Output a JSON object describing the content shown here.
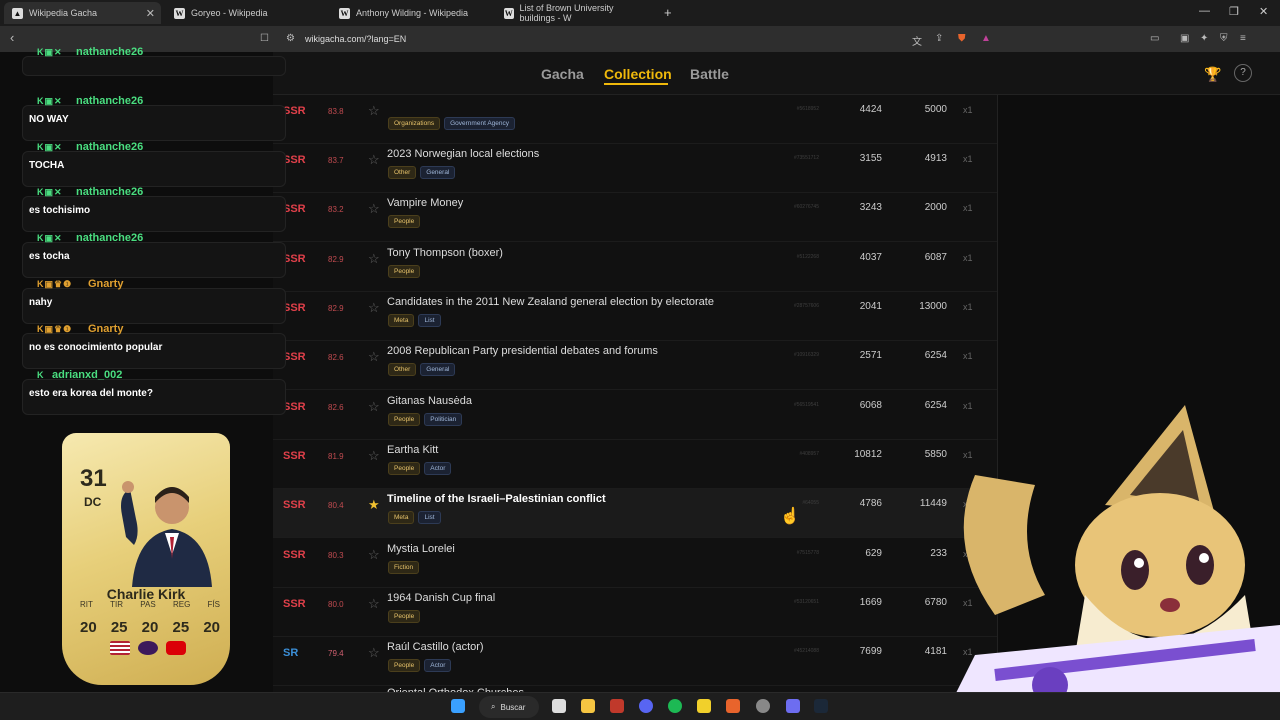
{
  "browser": {
    "tabs": [
      {
        "label": "Wikipedia Gacha",
        "active": true
      },
      {
        "label": "Goryeo - Wikipedia",
        "active": false
      },
      {
        "label": "Anthony Wilding - Wikipedia",
        "active": false
      },
      {
        "label": "List of Brown University buildings - W",
        "active": false
      }
    ],
    "new_tab": "+",
    "url": "wikigacha.com/?lang=EN"
  },
  "site": {
    "nav": [
      {
        "label": "Gacha"
      },
      {
        "label": "Collection",
        "active": true
      },
      {
        "label": "Battle"
      }
    ],
    "help": "?"
  },
  "rows": [
    {
      "rarity": "SSR",
      "score": "83.8",
      "title": "",
      "tags": [
        "Organizations",
        "Government Agency"
      ],
      "id": "#5618952",
      "v1": "4424",
      "v2": "5000",
      "count": "x1",
      "fav": false
    },
    {
      "rarity": "SSR",
      "score": "83.7",
      "title": "2023 Norwegian local elections",
      "tags": [
        "Other",
        "General"
      ],
      "id": "#73551712",
      "v1": "3155",
      "v2": "4913",
      "count": "x1",
      "fav": false
    },
    {
      "rarity": "SSR",
      "score": "83.2",
      "title": "Vampire Money",
      "tags": [
        "People"
      ],
      "id": "#60276745",
      "v1": "3243",
      "v2": "2000",
      "count": "x1",
      "fav": false
    },
    {
      "rarity": "SSR",
      "score": "82.9",
      "title": "Tony Thompson (boxer)",
      "tags": [
        "People"
      ],
      "id": "#5122268",
      "v1": "4037",
      "v2": "6087",
      "count": "x1",
      "fav": false
    },
    {
      "rarity": "SSR",
      "score": "82.9",
      "title": "Candidates in the 2011 New Zealand general election by electorate",
      "tags": [
        "Meta",
        "List"
      ],
      "id": "#28757606",
      "v1": "2041",
      "v2": "13000",
      "count": "x1",
      "fav": false
    },
    {
      "rarity": "SSR",
      "score": "82.6",
      "title": "2008 Republican Party presidential debates and forums",
      "tags": [
        "Other",
        "General"
      ],
      "id": "#10916329",
      "v1": "2571",
      "v2": "6254",
      "count": "x1",
      "fav": false
    },
    {
      "rarity": "SSR",
      "score": "82.6",
      "title": "Gitanas Nausėda",
      "tags": [
        "People",
        "Politician"
      ],
      "id": "#56519541",
      "v1": "6068",
      "v2": "6254",
      "count": "x1",
      "fav": false
    },
    {
      "rarity": "SSR",
      "score": "81.9",
      "title": "Eartha Kitt",
      "tags": [
        "People",
        "Actor"
      ],
      "id": "#408957",
      "v1": "10812",
      "v2": "5850",
      "count": "x1",
      "fav": false
    },
    {
      "rarity": "SSR",
      "score": "80.4",
      "title": "Timeline of the Israeli–Palestinian conflict",
      "tags": [
        "Meta",
        "List"
      ],
      "id": "#64055",
      "v1": "4786",
      "v2": "11449",
      "count": "x1",
      "fav": true
    },
    {
      "rarity": "SSR",
      "score": "80.3",
      "title": "Mystia Lorelei",
      "tags": [
        "Fiction"
      ],
      "id": "#7515778",
      "v1": "629",
      "v2": "233",
      "count": "x1",
      "fav": false
    },
    {
      "rarity": "SSR",
      "score": "80.0",
      "title": "1964 Danish Cup final",
      "tags": [
        "People"
      ],
      "id": "#53120651",
      "v1": "1669",
      "v2": "6780",
      "count": "x1",
      "fav": false
    },
    {
      "rarity": "SR",
      "score": "79.4",
      "title": "Raúl Castillo (actor)",
      "tags": [
        "People",
        "Actor"
      ],
      "id": "#45214088",
      "v1": "7699",
      "v2": "4181",
      "count": "x1",
      "fav": false
    },
    {
      "rarity": "",
      "score": "",
      "title": "Oriental Orthodox Churches",
      "tags": [],
      "id": "",
      "v1": "",
      "v2": "",
      "count": "",
      "fav": false
    }
  ],
  "chat": [
    {
      "user": "nathanche26",
      "color": "green",
      "text": ""
    },
    {
      "user": "nathanche26",
      "color": "green",
      "text": "NO WAY"
    },
    {
      "user": "nathanche26",
      "color": "green",
      "text": "TOCHA"
    },
    {
      "user": "nathanche26",
      "color": "green",
      "text": "es tochisimo"
    },
    {
      "user": "nathanche26",
      "color": "green",
      "text": "es tocha"
    },
    {
      "user": "Gnarty",
      "color": "orange",
      "text": "nahy"
    },
    {
      "user": "Gnarty",
      "color": "orange",
      "text": "no es conocimiento popular"
    },
    {
      "user": "adrianxd_002",
      "color": "green",
      "text": "esto era korea del monte?"
    }
  ],
  "card": {
    "rating": "31",
    "position": "DC",
    "name": "Charlie Kirk",
    "stat_labels": [
      "RIT",
      "TIR",
      "PAS",
      "REG",
      "FÍS"
    ],
    "stat_values": [
      "20",
      "25",
      "20",
      "25",
      "20"
    ]
  },
  "taskbar": {
    "search": "Buscar"
  },
  "colors": {
    "accent": "#f0b90b",
    "ssr": "#e0404a",
    "sr": "#3b8fd8",
    "chat_green": "#4ade80"
  }
}
